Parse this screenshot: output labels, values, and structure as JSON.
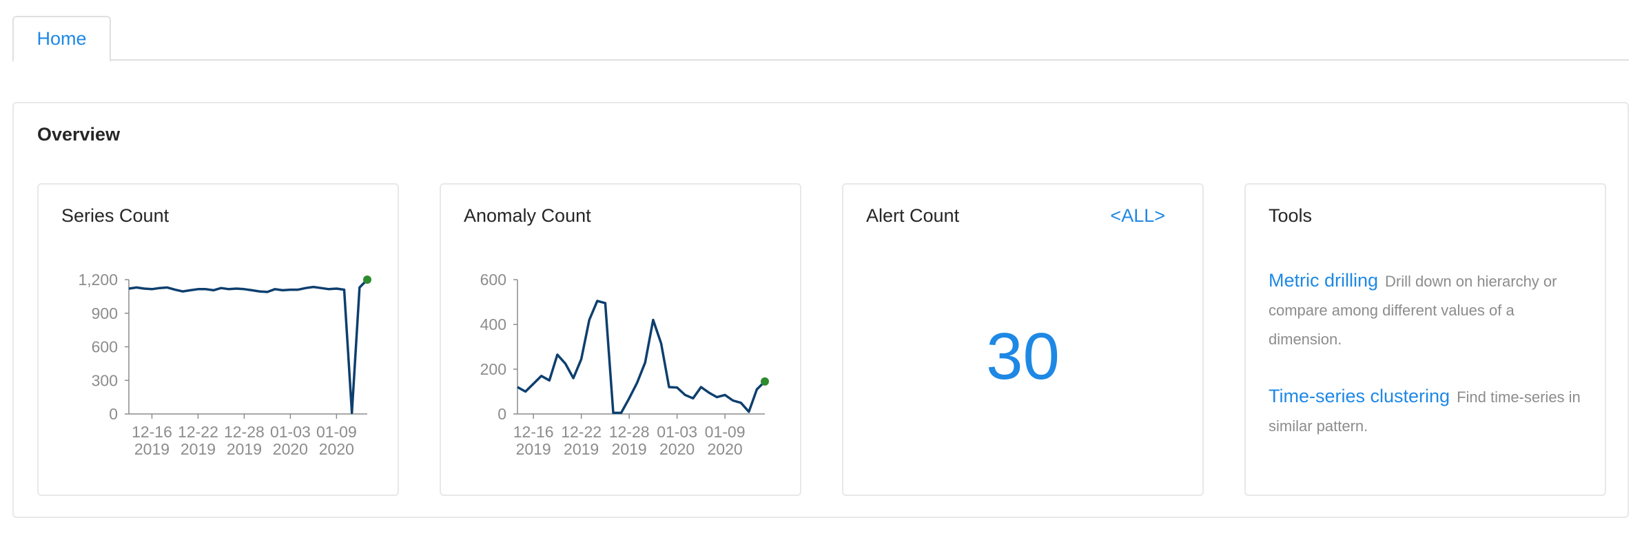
{
  "tabs": [
    {
      "label": "Home"
    }
  ],
  "overview": {
    "title": "Overview",
    "series_card": {
      "title": "Series Count"
    },
    "anomaly_card": {
      "title": "Anomaly Count"
    },
    "alert_card": {
      "title": "Alert Count",
      "filter_link": "<ALL>",
      "value": "30"
    },
    "tools_card": {
      "title": "Tools",
      "items": [
        {
          "link": "Metric drilling",
          "description": "Drill down on hierarchy or compare among different values of a dimension."
        },
        {
          "link": "Time-series clustering",
          "description": "Find time-series in similar pattern."
        }
      ]
    }
  },
  "colors": {
    "accent": "#1e88e5",
    "line": "#0d3f6e",
    "marker": "#2e8b2e"
  },
  "chart_data": [
    {
      "type": "line",
      "title": "Series Count",
      "x_tick_labels": [
        [
          "12-16",
          "2019"
        ],
        [
          "12-22",
          "2019"
        ],
        [
          "12-28",
          "2019"
        ],
        [
          "01-03",
          "2020"
        ],
        [
          "01-09",
          "2020"
        ]
      ],
      "x_tick_days": [
        3,
        9,
        15,
        21,
        27
      ],
      "x": [
        0,
        1,
        2,
        3,
        4,
        5,
        6,
        7,
        8,
        9,
        10,
        11,
        12,
        13,
        14,
        15,
        16,
        17,
        18,
        19,
        20,
        21,
        22,
        23,
        24,
        25,
        26,
        27,
        28,
        29,
        30,
        31
      ],
      "values": [
        1120,
        1130,
        1120,
        1115,
        1125,
        1130,
        1110,
        1095,
        1105,
        1115,
        1115,
        1105,
        1125,
        1115,
        1120,
        1115,
        1105,
        1095,
        1090,
        1115,
        1105,
        1110,
        1110,
        1125,
        1135,
        1125,
        1115,
        1120,
        1110,
        10,
        1130,
        1200
      ],
      "yticks": [
        0,
        300,
        600,
        900,
        1200
      ],
      "ytick_labels": [
        "0",
        "300",
        "600",
        "900",
        "1,200"
      ],
      "ylim": [
        0,
        1200
      ],
      "xlim": [
        0,
        31
      ],
      "last_point_marker": true
    },
    {
      "type": "line",
      "title": "Anomaly Count",
      "x_tick_labels": [
        [
          "12-16",
          "2019"
        ],
        [
          "12-22",
          "2019"
        ],
        [
          "12-28",
          "2019"
        ],
        [
          "01-03",
          "2020"
        ],
        [
          "01-09",
          "2020"
        ]
      ],
      "x_tick_days": [
        2,
        8,
        14,
        20,
        26
      ],
      "x": [
        0,
        1,
        2,
        3,
        4,
        5,
        6,
        7,
        8,
        9,
        10,
        11,
        12,
        13,
        14,
        15,
        16,
        17,
        18,
        19,
        20,
        21,
        22,
        23,
        24,
        25,
        26,
        27,
        28,
        29,
        30,
        31
      ],
      "values": [
        120,
        100,
        135,
        170,
        150,
        265,
        225,
        160,
        245,
        420,
        505,
        495,
        5,
        5,
        70,
        140,
        230,
        420,
        315,
        120,
        118,
        85,
        70,
        120,
        95,
        75,
        85,
        60,
        50,
        10,
        110,
        145
      ],
      "yticks": [
        0,
        200,
        400,
        600
      ],
      "ytick_labels": [
        "0",
        "200",
        "400",
        "600"
      ],
      "ylim": [
        0,
        600
      ],
      "xlim": [
        0,
        31
      ],
      "last_point_marker": true
    }
  ]
}
